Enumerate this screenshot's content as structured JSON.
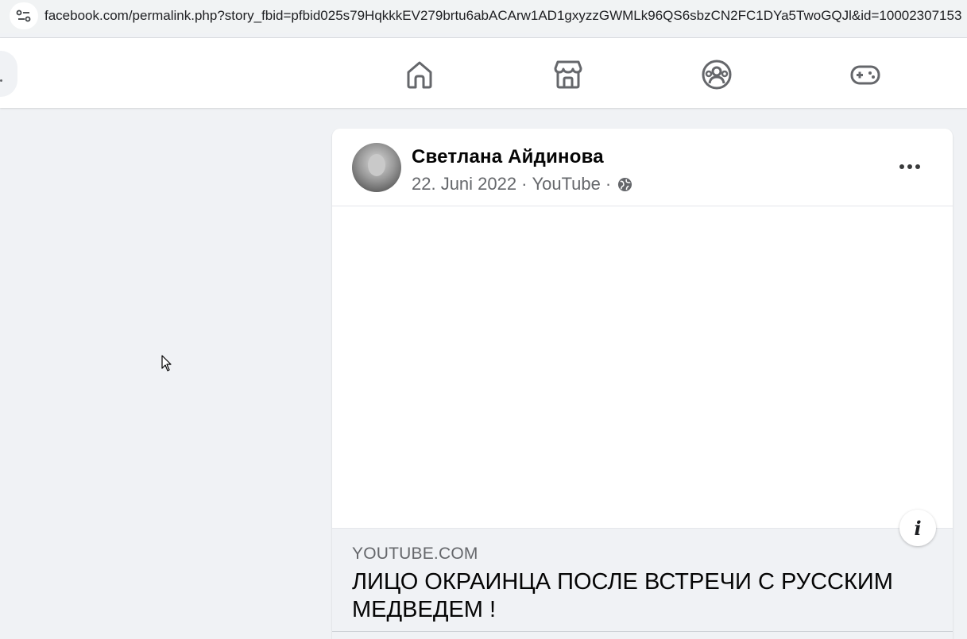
{
  "browser": {
    "url": "facebook.com/permalink.php?story_fbid=pfbid025s79HqkkkEV279brtu6abACArw1AD1gxyzzGWMLk96QS6sbzCN2FC1DYa5TwoGQJl&id=10002307153"
  },
  "nav": {
    "icons": [
      "home-icon",
      "marketplace-icon",
      "groups-icon",
      "gaming-icon"
    ]
  },
  "post": {
    "author": "Светлана Айдинова",
    "date": "22. Juni 2022",
    "source": "YouTube",
    "separator": "·",
    "link": {
      "domain": "YOUTUBE.COM",
      "title": "ЛИЦО ОКРАИНЦА ПОСЛЕ ВСТРЕЧИ С РУССКИМ МЕДВЕДЕМ !"
    },
    "info_label": "i"
  },
  "colors": {
    "page_bg": "#f0f2f5",
    "card_bg": "#ffffff",
    "secondary_text": "#65676b",
    "icon": "#65676b"
  }
}
